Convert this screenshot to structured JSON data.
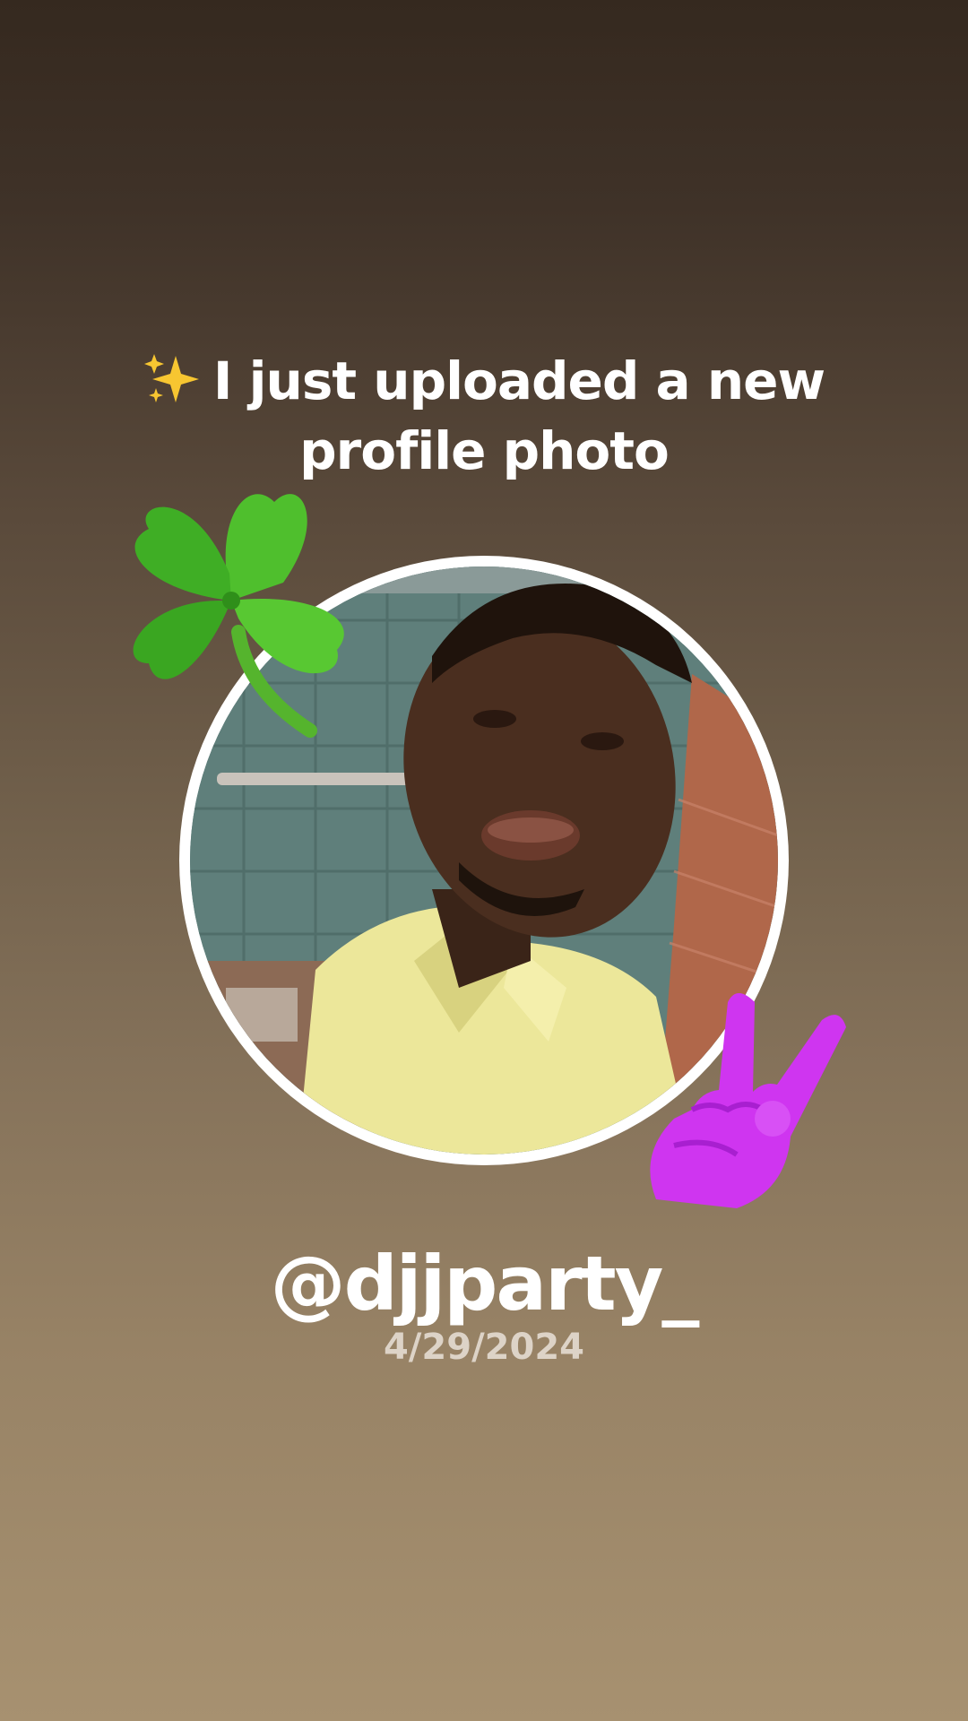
{
  "story": {
    "headline": "I just uploaded a new profile photo",
    "headline_icon": "sparkles-icon",
    "username": "@djjparty_",
    "date": "4/29/2024"
  },
  "decorations": {
    "top_left_sticker": "four-leaf-clover-icon",
    "bottom_right_sticker": "sign-of-the-horns-hand-icon"
  },
  "avatar": {
    "subject": "profile-photo"
  },
  "colors": {
    "background_top": "#35291f",
    "background_bottom": "#a79170",
    "text_primary": "#ffffff",
    "text_secondary": "#ddd3c7",
    "ring": "#ffffff",
    "clover": "#4cbb2b",
    "horns_hand": "#cc33ee"
  }
}
